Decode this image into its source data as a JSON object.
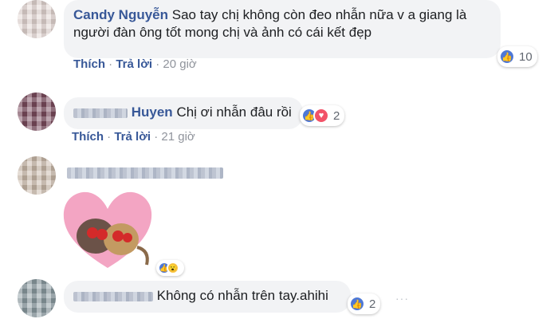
{
  "comments": [
    {
      "author": "Candy Nguyễn",
      "text": "Sao tay chị không còn đeo nhẫn nữa v a giang là",
      "text_line2": "người đàn ông tốt mong chị và ảnh có cái kết đẹp",
      "like_label": "Thích",
      "reply_label": "Trả lời",
      "time": "20 giờ",
      "reaction_count": "10"
    },
    {
      "author_visible": "Huyen",
      "text": "Chị ơi nhẫn đâu rồi",
      "like_label": "Thích",
      "reply_label": "Trả lời",
      "time": "21 giờ",
      "reaction_count": "2"
    },
    {
      "sticker": "cat-kissing-heart-sticker"
    },
    {
      "text": "Không có nhẫn trên tay.ahihi",
      "reaction_count": "2"
    }
  ],
  "separator": "·",
  "ellipsis": "···",
  "colors": {
    "link": "#385898",
    "bubble": "#f2f3f5",
    "like": "#4e78d6",
    "love": "#f25268",
    "heart_sticker": "#f3a5c3"
  }
}
